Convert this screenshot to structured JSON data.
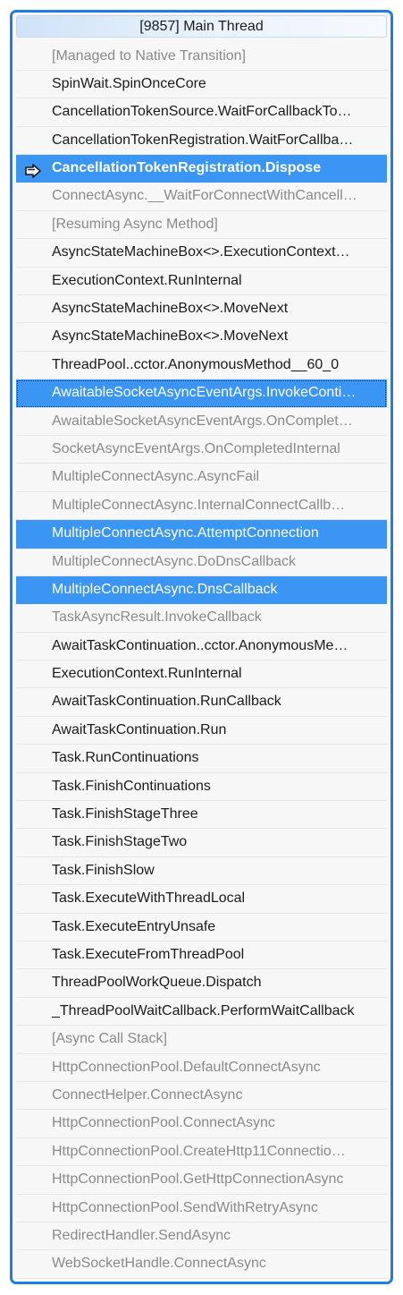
{
  "thread": {
    "title": "[9857] Main Thread"
  },
  "frames": [
    {
      "text": "[Managed to Native Transition]",
      "style": "external"
    },
    {
      "text": "SpinWait.SpinOnceCore",
      "style": "normal"
    },
    {
      "text": "CancellationTokenSource.WaitForCallbackTo…",
      "style": "normal"
    },
    {
      "text": "CancellationTokenRegistration.WaitForCallba…",
      "style": "normal"
    },
    {
      "text": "CancellationTokenRegistration.Dispose",
      "style": "active",
      "icon": "current-frame-arrow-icon"
    },
    {
      "text": "ConnectAsync.__WaitForConnectWithCancell…",
      "style": "external"
    },
    {
      "text": "[Resuming Async Method]",
      "style": "external"
    },
    {
      "text": "AsyncStateMachineBox<>.ExecutionContext…",
      "style": "normal"
    },
    {
      "text": "ExecutionContext.RunInternal",
      "style": "normal"
    },
    {
      "text": "AsyncStateMachineBox<>.MoveNext",
      "style": "normal"
    },
    {
      "text": "AsyncStateMachineBox<>.MoveNext",
      "style": "normal"
    },
    {
      "text": "ThreadPool..cctor.AnonymousMethod__60_0",
      "style": "normal"
    },
    {
      "text": "AwaitableSocketAsyncEventArgs.InvokeConti…",
      "style": "focused"
    },
    {
      "text": "AwaitableSocketAsyncEventArgs.OnComplet…",
      "style": "external"
    },
    {
      "text": "SocketAsyncEventArgs.OnCompletedInternal",
      "style": "external"
    },
    {
      "text": "MultipleConnectAsync.AsyncFail",
      "style": "external"
    },
    {
      "text": "MultipleConnectAsync.InternalConnectCallb…",
      "style": "external"
    },
    {
      "text": "MultipleConnectAsync.AttemptConnection",
      "style": "selected"
    },
    {
      "text": "MultipleConnectAsync.DoDnsCallback",
      "style": "external"
    },
    {
      "text": "MultipleConnectAsync.DnsCallback",
      "style": "selected"
    },
    {
      "text": "TaskAsyncResult.InvokeCallback",
      "style": "external"
    },
    {
      "text": "AwaitTaskContinuation..cctor.AnonymousMe…",
      "style": "normal"
    },
    {
      "text": "ExecutionContext.RunInternal",
      "style": "normal"
    },
    {
      "text": "AwaitTaskContinuation.RunCallback",
      "style": "normal"
    },
    {
      "text": "AwaitTaskContinuation.Run",
      "style": "normal"
    },
    {
      "text": "Task.RunContinuations",
      "style": "normal"
    },
    {
      "text": "Task.FinishContinuations",
      "style": "normal"
    },
    {
      "text": "Task.FinishStageThree",
      "style": "normal"
    },
    {
      "text": "Task.FinishStageTwo",
      "style": "normal"
    },
    {
      "text": "Task.FinishSlow",
      "style": "normal"
    },
    {
      "text": "Task.ExecuteWithThreadLocal",
      "style": "normal"
    },
    {
      "text": "Task.ExecuteEntryUnsafe",
      "style": "normal"
    },
    {
      "text": "Task.ExecuteFromThreadPool",
      "style": "normal"
    },
    {
      "text": "ThreadPoolWorkQueue.Dispatch",
      "style": "normal"
    },
    {
      "text": "_ThreadPoolWaitCallback.PerformWaitCallback",
      "style": "normal"
    },
    {
      "text": "[Async Call Stack]",
      "style": "external"
    },
    {
      "text": "HttpConnectionPool.DefaultConnectAsync",
      "style": "external"
    },
    {
      "text": "ConnectHelper.ConnectAsync",
      "style": "external"
    },
    {
      "text": "HttpConnectionPool.ConnectAsync",
      "style": "external"
    },
    {
      "text": "HttpConnectionPool.CreateHttp11Connectio…",
      "style": "external"
    },
    {
      "text": "HttpConnectionPool.GetHttpConnectionAsync",
      "style": "external"
    },
    {
      "text": "HttpConnectionPool.SendWithRetryAsync",
      "style": "external"
    },
    {
      "text": "RedirectHandler.SendAsync",
      "style": "external"
    },
    {
      "text": "WebSocketHandle.ConnectAsync",
      "style": "external"
    }
  ],
  "colors": {
    "border": "#1e7fe0",
    "selection": "#3a96f2",
    "external_text": "#8a8a8a",
    "normal_text": "#1b1b1b"
  }
}
